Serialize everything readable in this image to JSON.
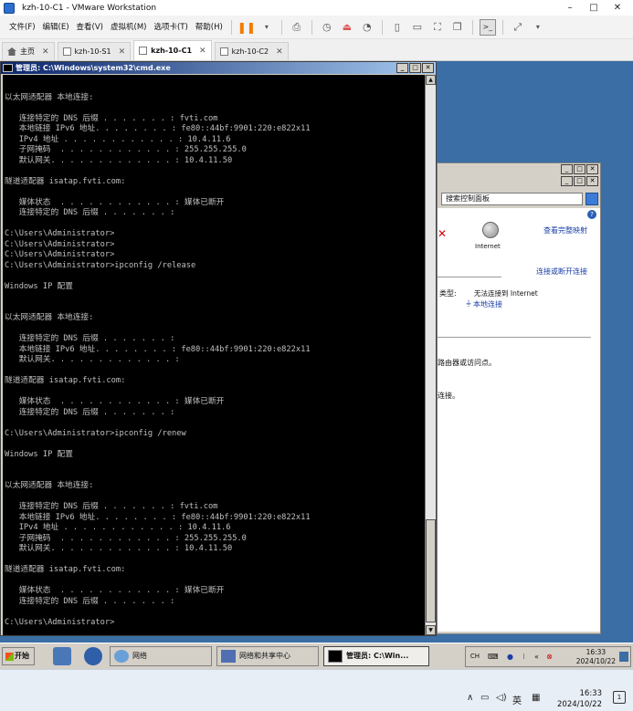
{
  "vmware": {
    "title": "kzh-10-C1 - VMware Workstation",
    "window_controls": {
      "minimize": "–",
      "maximize": "□",
      "close": "✕"
    },
    "menu": [
      "文件(F)",
      "编辑(E)",
      "查看(V)",
      "虚拟机(M)",
      "选项卡(T)",
      "帮助(H)"
    ],
    "tabs": [
      {
        "label": "主页",
        "close": "✕",
        "active": false
      },
      {
        "label": "kzh-10-S1",
        "close": "✕",
        "active": false
      },
      {
        "label": "kzh-10-C1",
        "close": "✕",
        "active": true
      },
      {
        "label": "kzh-10-C2",
        "close": "✕",
        "active": false
      }
    ]
  },
  "cmd": {
    "title": "管理员: C:\\Windows\\system32\\cmd.exe",
    "lines": [
      "",
      "以太网适配器 本地连接:",
      "",
      "   连接特定的 DNS 后缀 . . . . . . . : fvti.com",
      "   本地链接 IPv6 地址. . . . . . . . : fe80::44bf:9901:220:e822x11",
      "   IPv4 地址 . . . . . . . . . . . . : 10.4.11.6",
      "   子网掩码  . . . . . . . . . . . . : 255.255.255.0",
      "   默认网关. . . . . . . . . . . . . : 10.4.11.50",
      "",
      "隧道适配器 isatap.fvti.com:",
      "",
      "   媒体状态  . . . . . . . . . . . . : 媒体已断开",
      "   连接特定的 DNS 后缀 . . . . . . . :",
      "",
      "C:\\Users\\Administrator>",
      "C:\\Users\\Administrator>",
      "C:\\Users\\Administrator>",
      "C:\\Users\\Administrator>ipconfig /release",
      "",
      "Windows IP 配置",
      "",
      "",
      "以太网适配器 本地连接:",
      "",
      "   连接特定的 DNS 后缀 . . . . . . . :",
      "   本地链接 IPv6 地址. . . . . . . . : fe80::44bf:9901:220:e822x11",
      "   默认网关. . . . . . . . . . . . . :",
      "",
      "隧道适配器 isatap.fvti.com:",
      "",
      "   媒体状态  . . . . . . . . . . . . : 媒体已断开",
      "   连接特定的 DNS 后缀 . . . . . . . :",
      "",
      "C:\\Users\\Administrator>ipconfig /renew",
      "",
      "Windows IP 配置",
      "",
      "",
      "以太网适配器 本地连接:",
      "",
      "   连接特定的 DNS 后缀 . . . . . . . : fvti.com",
      "   本地链接 IPv6 地址. . . . . . . . : fe80::44bf:9901:220:e822x11",
      "   IPv4 地址 . . . . . . . . . . . . : 10.4.11.6",
      "   子网掩码  . . . . . . . . . . . . : 255.255.255.0",
      "   默认网关. . . . . . . . . . . . . : 10.4.11.50",
      "",
      "隧道适配器 isatap.fvti.com:",
      "",
      "   媒体状态  . . . . . . . . . . . . : 媒体已断开",
      "   连接特定的 DNS 后缀 . . . . . . . :",
      "",
      "C:\\Users\\Administrator>"
    ]
  },
  "network_window": {
    "search_placeholder": "搜索控制面板",
    "view_full_map": "查看完整映射",
    "internet_label": "Internet",
    "connect_disconnect": "连接或断开连接",
    "type_label": "类型:",
    "no_internet": "无法连接到 Internet",
    "local_connection": "本地连接",
    "router_text": "路由器或访问点。",
    "connect_text": "连接。"
  },
  "guest_taskbar": {
    "start": "开始",
    "buttons": [
      {
        "label": "网络"
      },
      {
        "label": "网络和共享中心"
      },
      {
        "label": "管理员: C:\\Win..."
      }
    ],
    "tray_ch": "CH",
    "time": "16:33",
    "date": "2024/10/22"
  },
  "host_taskbar": {
    "lang": "英",
    "time": "16:33",
    "date": "2024/10/22",
    "notify_count": "1"
  }
}
